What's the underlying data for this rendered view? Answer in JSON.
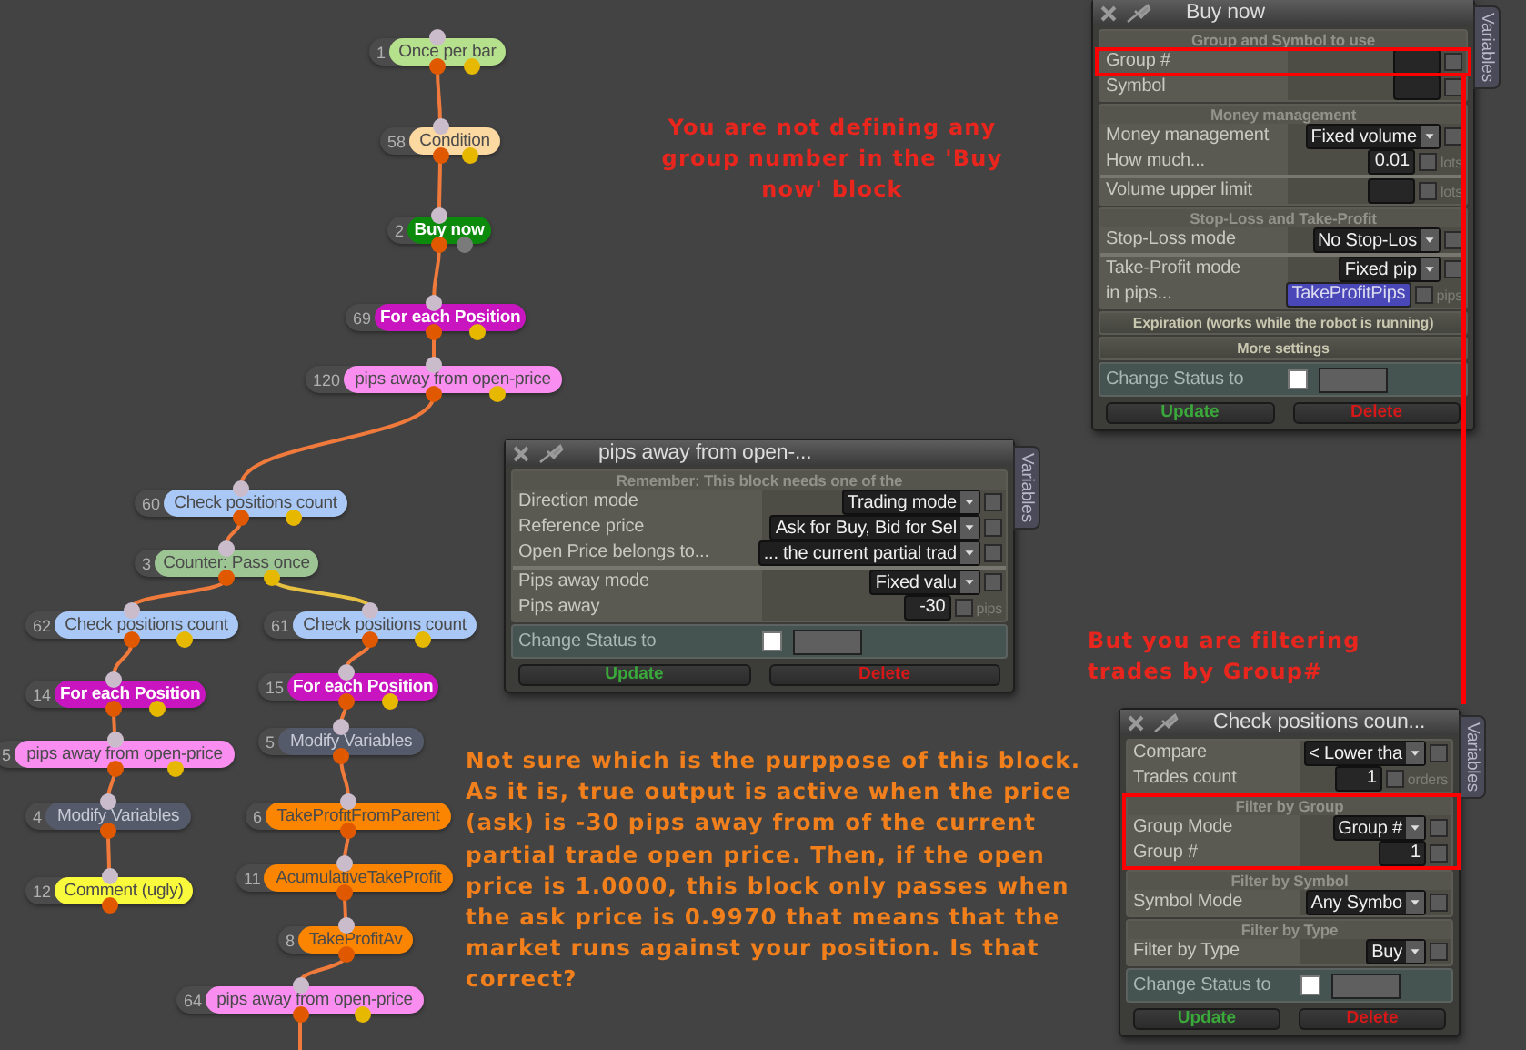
{
  "nodes": [
    {
      "number": "1",
      "label": "Once per bar",
      "color": "#b6e18c"
    },
    {
      "number": "58",
      "label": "Condition",
      "color": "#fdd9a2"
    },
    {
      "number": "2",
      "label": "Buy now",
      "color": "#0b8a0b"
    },
    {
      "number": "69",
      "label": "For each Position",
      "color": "#c815c0"
    },
    {
      "number": "120",
      "label": "pips away from open-price",
      "color": "#f98ef0"
    },
    {
      "number": "60",
      "label": "Check positions count",
      "color": "#a9c8f6"
    },
    {
      "number": "3",
      "label": "Counter: Pass once",
      "color": "#9dc594"
    },
    {
      "number": "62",
      "label": "Check positions count",
      "color": "#a9c8f6"
    },
    {
      "number": "61",
      "label": "Check positions count",
      "color": "#a9c8f6"
    },
    {
      "number": "14",
      "label": "For each Position",
      "color": "#c815c0"
    },
    {
      "number": "15",
      "label": "For each Position",
      "color": "#c815c0"
    },
    {
      "number": "5",
      "label": "pips away from open-price",
      "color": "#f98ef0"
    },
    {
      "number": "5",
      "label": "Modify Variables",
      "color": "#555a6a"
    },
    {
      "number": "4",
      "label": "Modify Variables",
      "color": "#555a6a"
    },
    {
      "number": "6",
      "label": "TakeProfitFromParent",
      "color": "#fb8500"
    },
    {
      "number": "11",
      "label": "AcumulativeTakeProfit",
      "color": "#fb8500"
    },
    {
      "number": "12",
      "label": "Comment (ugly)",
      "color": "#fafa3c"
    },
    {
      "number": "8",
      "label": "TakeProfitAv",
      "color": "#fb8500"
    },
    {
      "number": "64",
      "label": "pips away from open-price",
      "color": "#f98ef0"
    }
  ],
  "notes": [
    {
      "text": "You are not defining any group number in the 'Buy now' block",
      "color": "#e8261e"
    },
    {
      "text": "But you are filtering trades by Group#",
      "color": "#e8261e"
    },
    {
      "text": "Not sure which is the purppose of this block. As it is, true output is active when the price (ask) is -30 pips away from of the current partial trade open price. Then, if the open price is 1.0000, this block only passes when the ask price is 0.9970 that means that the market runs against your position. Is that correct?",
      "color": "#f07f1c"
    }
  ],
  "dialogs": [
    {
      "title": "Buy now",
      "side_tab": "Variables",
      "sections": [
        {
          "header": "Group and Symbol to use",
          "expanded": true,
          "groups": [
            [
              {
                "label": "Group #",
                "kind": "field",
                "checked": false
              },
              {
                "label": "Symbol",
                "kind": "field",
                "checked": false
              }
            ]
          ]
        },
        {
          "header": "Money management",
          "expanded": true,
          "groups": [
            [
              {
                "label": "Money management",
                "kind": "dropdown",
                "value": "Fixed volume",
                "checked": false
              },
              {
                "label": "How much...",
                "kind": "field",
                "value": "0.01",
                "checked": false,
                "unit": "lots"
              }
            ],
            [
              {
                "label": "Volume upper limit",
                "kind": "field",
                "checked": false,
                "unit": "lots"
              }
            ]
          ]
        },
        {
          "header": "Stop-Loss and Take-Profit",
          "expanded": true,
          "groups": [
            [
              {
                "label": "Stop-Loss mode",
                "kind": "dropdown",
                "value": "No Stop-Los",
                "checked": false
              }
            ],
            [
              {
                "label": "Take-Profit mode",
                "kind": "dropdown",
                "value": "Fixed pip",
                "checked": false
              },
              {
                "label": "in pips...",
                "kind": "variable",
                "value": "TakeProfitPips",
                "checked": false,
                "unit": "pips"
              }
            ]
          ]
        },
        {
          "header": "Expiration (works while the robot is running)",
          "expanded": false
        },
        {
          "header": "More settings",
          "expanded": false
        }
      ],
      "status": {
        "label": "Change Status to",
        "checked": false
      },
      "buttons": [
        {
          "label": "Update",
          "kind": "update"
        },
        {
          "label": "Delete",
          "kind": "delete"
        }
      ]
    },
    {
      "title": "pips away from open-...",
      "side_tab": "Variables",
      "sections": [
        {
          "header": "Remember: This block needs one of the",
          "expanded": true,
          "groups": [
            [
              {
                "label": "Direction mode",
                "kind": "dropdown",
                "value": "Trading mode",
                "checked": false
              },
              {
                "label": "Reference price",
                "kind": "dropdown",
                "value": "Ask for Buy, Bid for Sel",
                "checked": false
              },
              {
                "label": "Open Price belongs to...",
                "kind": "dropdown",
                "value": "... the current partial trad",
                "checked": false
              }
            ],
            [
              {
                "label": "Pips away mode",
                "kind": "dropdown",
                "value": "Fixed valu",
                "checked": false
              },
              {
                "label": "Pips away",
                "kind": "field",
                "value": "-30",
                "checked": false,
                "unit": "pips"
              }
            ]
          ]
        }
      ],
      "status": {
        "label": "Change Status to",
        "checked": false
      },
      "buttons": [
        {
          "label": "Update",
          "kind": "update"
        },
        {
          "label": "Delete",
          "kind": "delete"
        }
      ]
    },
    {
      "title": "Check positions coun...",
      "side_tab": "Variables",
      "sections": [
        {
          "expanded": true,
          "groups": [
            [
              {
                "label": "Compare",
                "kind": "dropdown",
                "value": "< Lower tha",
                "checked": false
              },
              {
                "label": "Trades count",
                "kind": "field",
                "value": "1",
                "checked": false,
                "unit": "orders"
              }
            ]
          ]
        },
        {
          "header": "Filter by Group",
          "expanded": true,
          "groups": [
            [
              {
                "label": "Group Mode",
                "kind": "dropdown",
                "value": "Group #",
                "checked": false
              },
              {
                "label": "Group #",
                "kind": "field",
                "value": "1",
                "checked": false
              }
            ]
          ]
        },
        {
          "header": "Filter by Symbol",
          "expanded": true,
          "groups": [
            [
              {
                "label": "Symbol Mode",
                "kind": "dropdown",
                "value": "Any Symbo",
                "checked": false
              }
            ]
          ]
        },
        {
          "header": "Filter by Type",
          "expanded": true,
          "groups": [
            [
              {
                "label": "Filter by Type",
                "kind": "dropdown",
                "value": "Buy",
                "checked": false
              }
            ]
          ]
        }
      ],
      "status": {
        "label": "Change Status to",
        "checked": false
      },
      "buttons": [
        {
          "label": "Update",
          "kind": "update"
        },
        {
          "label": "Delete",
          "kind": "delete"
        }
      ]
    }
  ]
}
